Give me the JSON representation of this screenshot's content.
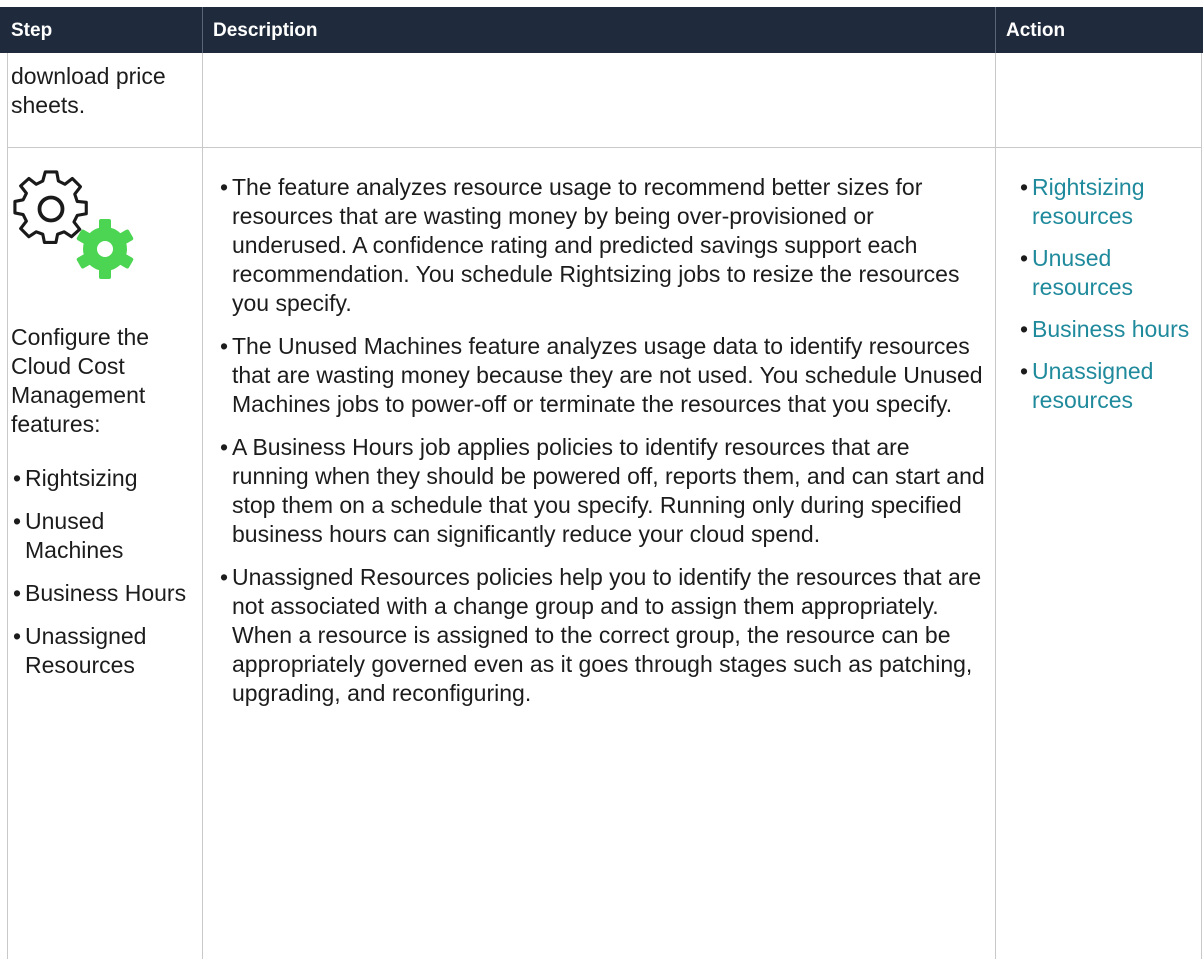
{
  "header": {
    "step": "Step",
    "description": "Description",
    "action": "Action"
  },
  "row1": {
    "step_text": "download price sheets."
  },
  "row2": {
    "icon": "gear-settings-icon",
    "accent_color": "#4cd552",
    "step_intro": "Configure the Cloud Cost Management features:",
    "step_items": [
      "Rightsizing",
      "Unused Machines",
      "Business Hours",
      "Unassigned Resources"
    ],
    "description_items": [
      "The feature analyzes resource usage to recommend better sizes for resources that are wasting money by being over-provisioned or underused. A confidence rating and predicted savings support each recommendation. You schedule Rightsizing jobs to resize the resources you specify.",
      "The Unused Machines feature analyzes usage data to identify resources that are wasting money because they are not used. You schedule Unused Machines jobs to power-off or terminate the resources that you specify.",
      "A Business Hours job applies policies to identify resources that are running when they should be powered off, reports them, and can start and stop them on a schedule that you specify. Running only during specified business hours can significantly reduce your cloud spend.",
      "Unassigned Resources policies help you to identify the resources that are not associated with a change group and to assign them appropriately. When a resource is assigned to the correct group, the resource can be appropriately governed even as it goes through stages such as patching, upgrading, and reconfiguring."
    ],
    "action_links": [
      "Rightsizing resources",
      "Unused resources",
      "Business hours",
      "Unassigned resources"
    ]
  },
  "colors": {
    "header_bg": "#1f2b3c",
    "link": "#1f8a9c",
    "border": "#c9c9c9"
  }
}
